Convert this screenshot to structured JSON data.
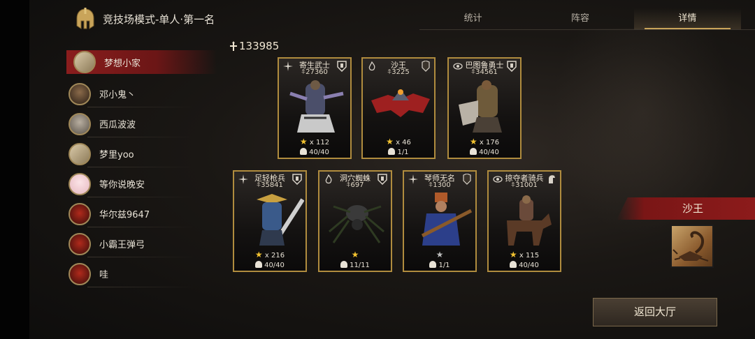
{
  "header": {
    "title": "竞技场模式-单人·第一名",
    "tabs": [
      {
        "label": "统计",
        "active": false
      },
      {
        "label": "阵容",
        "active": false
      },
      {
        "label": "详情",
        "active": true
      }
    ]
  },
  "players": [
    {
      "name": "梦想小家",
      "selected": true
    },
    {
      "name": "邓小鬼丶",
      "selected": false
    },
    {
      "name": "西瓜波波",
      "selected": false
    },
    {
      "name": "梦里yoo",
      "selected": false
    },
    {
      "name": "等你说晚安",
      "selected": false
    },
    {
      "name": "华尔兹9647",
      "selected": false
    },
    {
      "name": "小霸王弹弓",
      "selected": false
    },
    {
      "name": "哇",
      "selected": false
    }
  ],
  "total_power": "133985",
  "units": [
    {
      "name": "寄生武士",
      "power": "27360",
      "stars": "x 112",
      "troops": "40/40",
      "class_icon": "compass-icon",
      "tier_icon": "shield-icon"
    },
    {
      "name": "沙王",
      "power": "3225",
      "stars": "x 46",
      "troops": "1/1",
      "class_icon": "flame-icon",
      "tier_icon": "crest-icon"
    },
    {
      "name": "巴图鲁勇士",
      "power": "34561",
      "stars": "x 176",
      "troops": "40/40",
      "class_icon": "eye-icon",
      "tier_icon": "shield-icon"
    },
    {
      "name": "足轻枪兵",
      "power": "35841",
      "stars": "x 216",
      "troops": "40/40",
      "class_icon": "compass-icon",
      "tier_icon": "shield-icon"
    },
    {
      "name": "洞穴蜘蛛",
      "power": "697",
      "stars": "",
      "troops": "11/11",
      "class_icon": "flame-icon",
      "tier_icon": "shield-icon"
    },
    {
      "name": "琴师无名",
      "power": "1300",
      "stars": "",
      "troops": "1/1",
      "class_icon": "compass-icon",
      "tier_icon": "crest-icon"
    },
    {
      "name": "掠夺者骑兵",
      "power": "31001",
      "stars": "x 115",
      "troops": "40/40",
      "class_icon": "eye-icon",
      "tier_icon": "horse-icon"
    }
  ],
  "selected_unit": {
    "name": "沙王"
  },
  "return_button": "返回大厅",
  "colors": {
    "accent_gold": "#b08c3e",
    "selected_red": "#8a1d1d",
    "star_gold": "#f2c230"
  }
}
